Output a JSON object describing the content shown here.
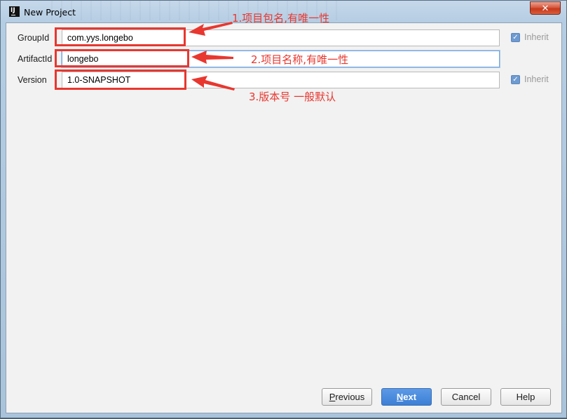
{
  "window": {
    "title": "New Project",
    "app_icon_text": "IJ",
    "close_glyph": "✕"
  },
  "form": {
    "fields": [
      {
        "label": "GroupId",
        "value": "com.yys.longebo",
        "inherit": true,
        "inherit_label": "Inherit",
        "focused": false
      },
      {
        "label": "ArtifactId",
        "value": "longebo",
        "inherit": false,
        "focused": true
      },
      {
        "label": "Version",
        "value": "1.0-SNAPSHOT",
        "inherit": true,
        "inherit_label": "Inherit",
        "focused": false
      }
    ]
  },
  "annotations": [
    {
      "text": "1.项目包名,有唯一性"
    },
    {
      "text": "2.项目名称,有唯一性"
    },
    {
      "text": "3.版本号 一般默认"
    }
  ],
  "annotation_color": "#e8372f",
  "buttons": {
    "previous": {
      "label_mnemonic": "P",
      "label_rest": "revious"
    },
    "next": {
      "label_mnemonic": "N",
      "label_rest": "ext"
    },
    "cancel": {
      "label": "Cancel"
    },
    "help": {
      "label": "Help"
    }
  },
  "checkbox_glyph": "✓"
}
